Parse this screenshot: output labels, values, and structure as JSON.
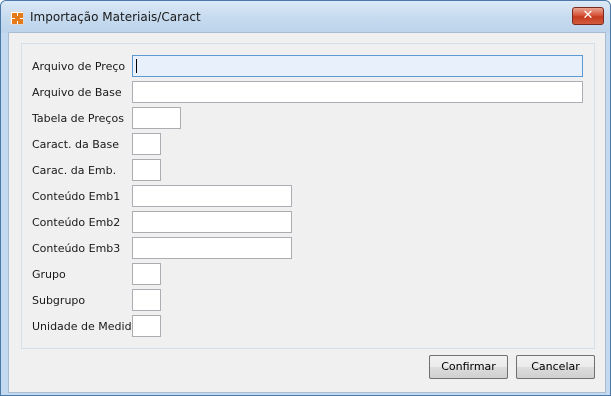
{
  "window": {
    "title": "Importação Materiais/Caract",
    "close_label": "✕",
    "app_icon": "app-icon"
  },
  "form": {
    "fields": [
      {
        "label": "Arquivo de Preço",
        "value": ""
      },
      {
        "label": "Arquivo de Base",
        "value": ""
      },
      {
        "label": "Tabela de Preços",
        "value": ""
      },
      {
        "label": "Caract. da Base",
        "value": ""
      },
      {
        "label": "Carac. da Emb.",
        "value": ""
      },
      {
        "label": "Conteúdo Emb1",
        "value": ""
      },
      {
        "label": "Conteúdo Emb2",
        "value": ""
      },
      {
        "label": "Conteúdo Emb3",
        "value": ""
      },
      {
        "label": "Grupo",
        "value": ""
      },
      {
        "label": "Subgrupo",
        "value": ""
      },
      {
        "label": "Unidade de Medida",
        "value": ""
      }
    ]
  },
  "buttons": {
    "confirm": "Confirmar",
    "cancel": "Cancelar"
  }
}
